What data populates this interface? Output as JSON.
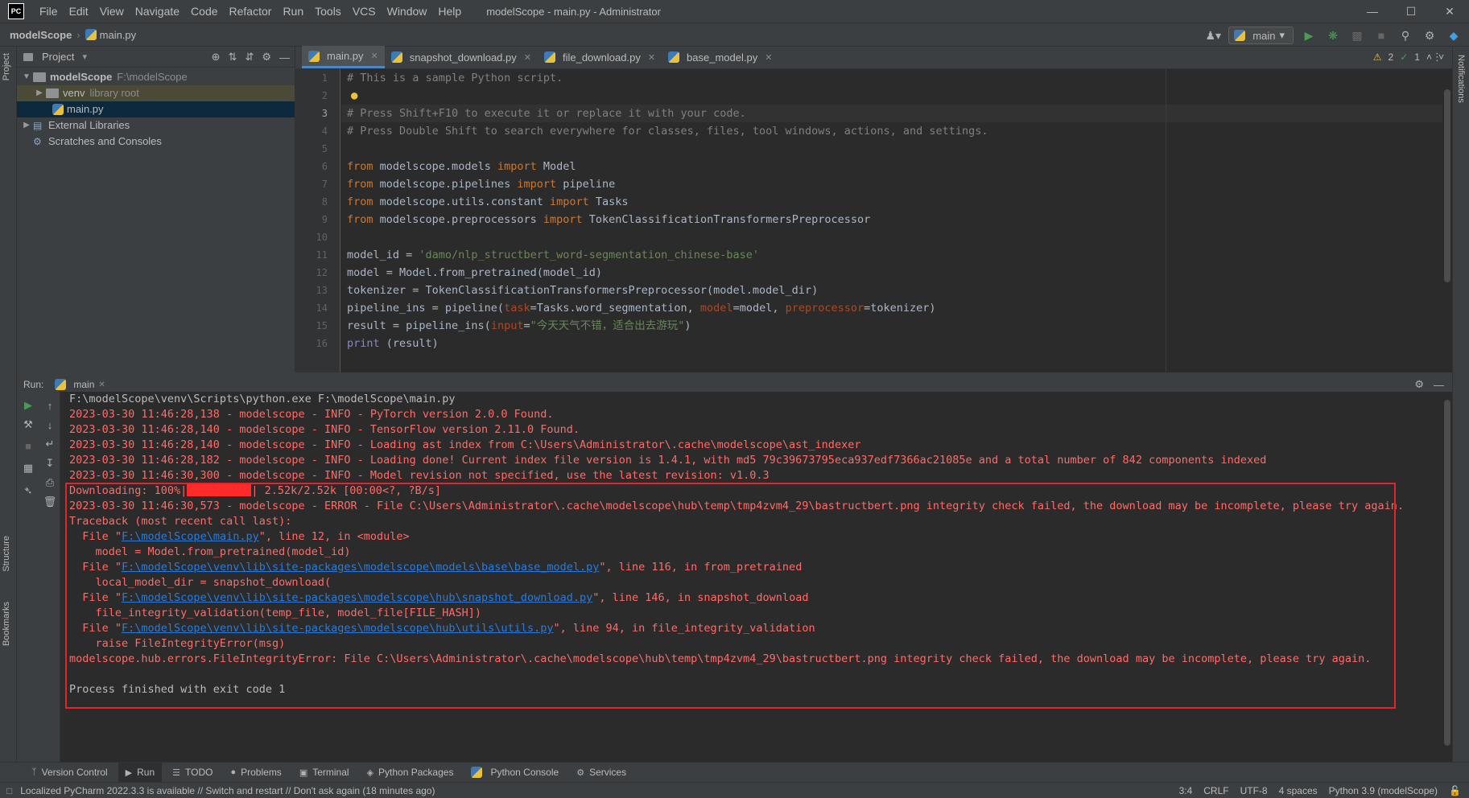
{
  "app": {
    "logo_text": "PC",
    "window_title": "modelScope - main.py - Administrator"
  },
  "menu": [
    "File",
    "Edit",
    "View",
    "Navigate",
    "Code",
    "Refactor",
    "Run",
    "Tools",
    "VCS",
    "Window",
    "Help"
  ],
  "nav": {
    "project": "modelScope",
    "file": "main.py",
    "run_config": "main"
  },
  "project_panel": {
    "title": "Project",
    "tree": [
      {
        "label": "modelScope",
        "path": "F:\\modelScope"
      },
      {
        "label": "venv",
        "note": "library root"
      },
      {
        "label": "main.py"
      },
      {
        "label": "External Libraries"
      },
      {
        "label": "Scratches and Consoles"
      }
    ]
  },
  "editor": {
    "tabs": [
      "main.py",
      "snapshot_download.py",
      "file_download.py",
      "base_model.py"
    ],
    "inspection": {
      "warnings": "2",
      "ok": "1"
    },
    "line_numbers": [
      "1",
      "2",
      "3",
      "4",
      "5",
      "6",
      "7",
      "8",
      "9",
      "10",
      "11",
      "12",
      "13",
      "14",
      "15",
      "16"
    ],
    "lines": {
      "l1": "# This is a sample Python script.",
      "l3": "# Press Shift+F10 to execute it or replace it with your code.",
      "l4": "# Press Double Shift to search everywhere for classes, files, tool windows, actions, and settings.",
      "l6_mod": "modelscope.models",
      "l6_name": "Model",
      "l7_mod": "modelscope.pipelines",
      "l7_name": "pipeline",
      "l8_mod": "modelscope.utils.constant",
      "l8_name": "Tasks",
      "l9_mod": "modelscope.preprocessors",
      "l9_name": "TokenClassificationTransformersPreprocessor",
      "l11_a": "model_id = ",
      "l11_str": "'damo/nlp_structbert_word-segmentation_chinese-base'",
      "l12": "model = Model.from_pretrained(model_id)",
      "l13": "tokenizer = TokenClassificationTransformersPreprocessor(model.model_dir)",
      "l14_a": "pipeline_ins = pipeline(",
      "l14_task": "task",
      "l14_b": "=Tasks.word_segmentation, ",
      "l14_model": "model",
      "l14_c": "=model, ",
      "l14_pre": "preprocessor",
      "l14_d": "=tokenizer)",
      "l15_a": "result = pipeline_ins(",
      "l15_input": "input",
      "l15_b": "=",
      "l15_str": "\"今天天气不错，适合出去游玩\"",
      "l15_c": ")",
      "l16_fn": "print",
      "l16_b": " (result)"
    },
    "kw_from": "from",
    "kw_import": "import"
  },
  "run_panel": {
    "label": "Run:",
    "tab": "main",
    "output": {
      "cmd": "F:\\modelScope\\venv\\Scripts\\python.exe F:\\modelScope\\main.py",
      "log1": "2023-03-30 11:46:28,138 - modelscope - INFO - PyTorch version 2.0.0 Found.",
      "log2": "2023-03-30 11:46:28,140 - modelscope - INFO - TensorFlow version 2.11.0 Found.",
      "log3": "2023-03-30 11:46:28,140 - modelscope - INFO - Loading ast index from C:\\Users\\Administrator\\.cache\\modelscope\\ast_indexer",
      "log4": "2023-03-30 11:46:28,182 - modelscope - INFO - Loading done! Current index file version is 1.4.1, with md5 79c39673795eca937edf7366ac21085e and a total number of 842 components indexed",
      "log5": "2023-03-30 11:46:30,300 - modelscope - INFO - Model revision not specified, use the latest revision: v1.0.3",
      "dl_a": "Downloading: 100%|",
      "dl_b": "| 2.52k/2.52k [00:00<?, ?B/s]",
      "dl_progress": 1.0,
      "err1": "2023-03-30 11:46:30,573 - modelscope - ERROR - File C:\\Users\\Administrator\\.cache\\modelscope\\hub\\temp\\tmp4zvm4_29\\bastructbert.png integrity check failed, the download may be incomplete, please try again.",
      "tb": "Traceback (most recent call last):",
      "f1_a": "  File \"",
      "f1_link": "F:\\modelScope\\main.py",
      "f1_b": "\", line 12, in <module>",
      "f1_code": "    model = Model.from_pretrained(model_id)",
      "f2_link": "F:\\modelScope\\venv\\lib\\site-packages\\modelscope\\models\\base\\base_model.py",
      "f2_b": "\", line 116, in from_pretrained",
      "f2_code": "    local_model_dir = snapshot_download(",
      "f3_link": "F:\\modelScope\\venv\\lib\\site-packages\\modelscope\\hub\\snapshot_download.py",
      "f3_b": "\", line 146, in snapshot_download",
      "f3_code": "    file_integrity_validation(temp_file, model_file[FILE_HASH])",
      "f4_link": "F:\\modelScope\\venv\\lib\\site-packages\\modelscope\\hub\\utils\\utils.py",
      "f4_b": "\", line 94, in file_integrity_validation",
      "f4_code": "    raise FileIntegrityError(msg)",
      "final_err": "modelscope.hub.errors.FileIntegrityError: File C:\\Users\\Administrator\\.cache\\modelscope\\hub\\temp\\tmp4zvm4_29\\bastructbert.png integrity check failed, the download may be incomplete, please try again.",
      "exit": "Process finished with exit code 1"
    }
  },
  "left_strip": {
    "project": "Project",
    "structure": "Structure",
    "bookmarks": "Bookmarks"
  },
  "right_strip": {
    "notifications": "Notifications"
  },
  "bottom_tools": [
    "Version Control",
    "Run",
    "TODO",
    "Problems",
    "Terminal",
    "Python Packages",
    "Python Console",
    "Services"
  ],
  "status": {
    "message": "Localized PyCharm 2022.3.3 is available // Switch and restart // Don't ask again (18 minutes ago)",
    "position": "3:4",
    "line_sep": "CRLF",
    "encoding": "UTF-8",
    "indent": "4 spaces",
    "interpreter": "Python 3.9 (modelScope)"
  },
  "colors": {
    "error": "#ff6b68",
    "error_box": "#e0262c",
    "link": "#287bde",
    "accent": "#4a88c7"
  }
}
